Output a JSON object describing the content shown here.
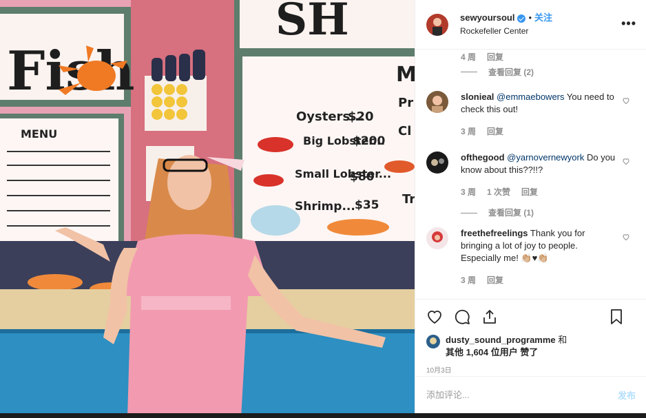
{
  "photo": {
    "description_icon": "photo",
    "sign_fish": "Fish",
    "sign_top": "SH",
    "menu_title": "MENU",
    "menu_items": [
      {
        "item": "Oysters...",
        "price": "$20"
      },
      {
        "item": "Big Lobster...",
        "price": "$200"
      },
      {
        "item": "Small Lobster...",
        "price": "$80"
      },
      {
        "item": "Shrimp...",
        "price": "$35"
      }
    ],
    "menu_letter_top": "M",
    "menu_side_1": "Pr",
    "menu_side_2": "Cl",
    "menu_side_3": "Tr"
  },
  "header": {
    "username": "sewyoursoul",
    "dot": "•",
    "follow_label": "关注",
    "location": "Rockefeller Center",
    "more_label": "•••"
  },
  "comments": {
    "top": {
      "time": "4 周",
      "reply": "回复",
      "view_replies": "查看回复 (2)"
    },
    "items": [
      {
        "user": "slonieal",
        "mention": "@emmaebowers",
        "text": " You need to check this out!",
        "time": "3 周",
        "likes": "",
        "reply": "回复",
        "view_replies": ""
      },
      {
        "user": "ofthegood",
        "mention": "@yarnovernewyork",
        "text": " Do you know about this??!!?",
        "time": "3 周",
        "likes": "1 次赞",
        "reply": "回复",
        "view_replies": "查看回复 (1)"
      },
      {
        "user": "freethefreelings",
        "mention": "",
        "text": " Thank you for bringing a lot of joy to people. Especially me! 👏🏼♥👏🏼",
        "time": "3 周",
        "likes": "",
        "reply": "回复",
        "view_replies": ""
      }
    ]
  },
  "actions": {
    "icons": [
      "heart-icon",
      "comment-icon",
      "share-icon",
      "bookmark-icon"
    ],
    "liked_by_user": "dusty_sound_programme",
    "liked_by_and": " 和",
    "liked_by_others": "其他 1,604 位用户",
    "liked_suffix": " 赞了",
    "date": "10月3日"
  },
  "add_comment": {
    "placeholder": "添加评论...",
    "post_label": "发布"
  },
  "colors": {
    "accent": "#3897f0",
    "post_disabled": "#b2dffc",
    "muted": "#8e8e8e",
    "mention": "#003569"
  }
}
